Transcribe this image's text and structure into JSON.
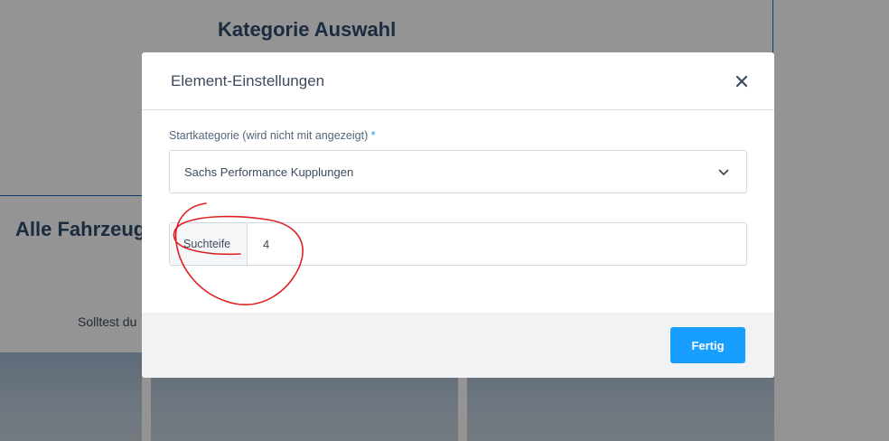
{
  "background": {
    "heading": "Kategorie Auswahl",
    "section_title": "Alle Fahrzeugr",
    "subtext": "Solltest du"
  },
  "modal": {
    "title": "Element-Einstellungen",
    "close_icon": "close-icon",
    "start_category": {
      "label": "Startkategorie (wird nicht mit angezeigt)",
      "required_marker": "*",
      "selected_value": "Sachs Performance Kupplungen",
      "icon": "chevron-down-icon"
    },
    "search_depth": {
      "label": "Suchteife",
      "value": "4"
    },
    "done_label": "Fertig"
  },
  "colors": {
    "accent": "#189eff",
    "annotation": "#e02020",
    "heading": "#2f4b6f"
  }
}
